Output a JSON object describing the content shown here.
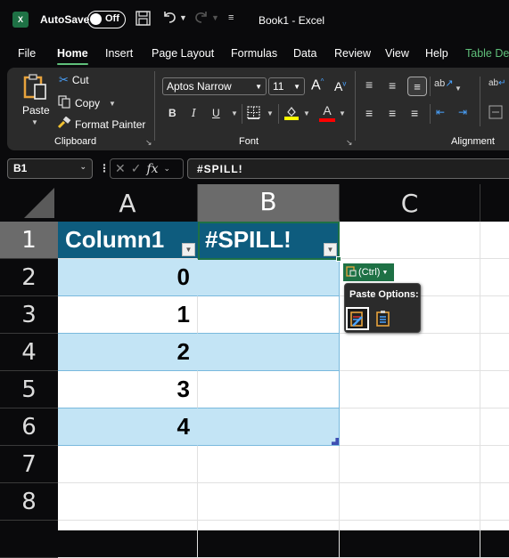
{
  "titlebar": {
    "app_icon": "excel-logo-icon",
    "app_letter": "X",
    "autosave_label": "AutoSave",
    "autosave_state": "Off",
    "title": "Book1  -  Excel"
  },
  "ribbon_tabs": [
    {
      "label": "File"
    },
    {
      "label": "Home",
      "active": true
    },
    {
      "label": "Insert"
    },
    {
      "label": "Page Layout"
    },
    {
      "label": "Formulas"
    },
    {
      "label": "Data"
    },
    {
      "label": "Review"
    },
    {
      "label": "View"
    },
    {
      "label": "Help"
    },
    {
      "label": "Table De",
      "contextual": true
    }
  ],
  "clipboard": {
    "paste_label": "Paste",
    "cut_label": "Cut",
    "copy_label": "Copy",
    "format_painter_label": "Format Painter",
    "group_label": "Clipboard"
  },
  "font": {
    "font_name": "Aptos Narrow",
    "font_size": "11",
    "bold": "B",
    "italic": "I",
    "underline": "U",
    "grow": "A",
    "shrink": "A",
    "font_color_letter": "A",
    "highlight_color": "#ffff00",
    "font_color": "#ff0000",
    "group_label": "Font"
  },
  "alignment": {
    "group_label": "Alignment"
  },
  "formula_bar": {
    "name_box": "B1",
    "fx_label": "fx",
    "formula": "#SPILL!"
  },
  "grid": {
    "columns": [
      "A",
      "B",
      "C"
    ],
    "rows": [
      "1",
      "2",
      "3",
      "4",
      "5",
      "6",
      "7",
      "8"
    ],
    "table_headers": [
      "Column1",
      "#SPILL!"
    ],
    "column_a_values": [
      "0",
      "1",
      "2",
      "3",
      "4"
    ]
  },
  "paste_options": {
    "button_label": "(Ctrl)",
    "menu_title": "Paste Options:"
  },
  "colors": {
    "accent_green": "#1e7145",
    "table_header": "#0e5c7e",
    "table_band": "#c3e4f5",
    "contextual_tab": "#5fbf7a"
  }
}
